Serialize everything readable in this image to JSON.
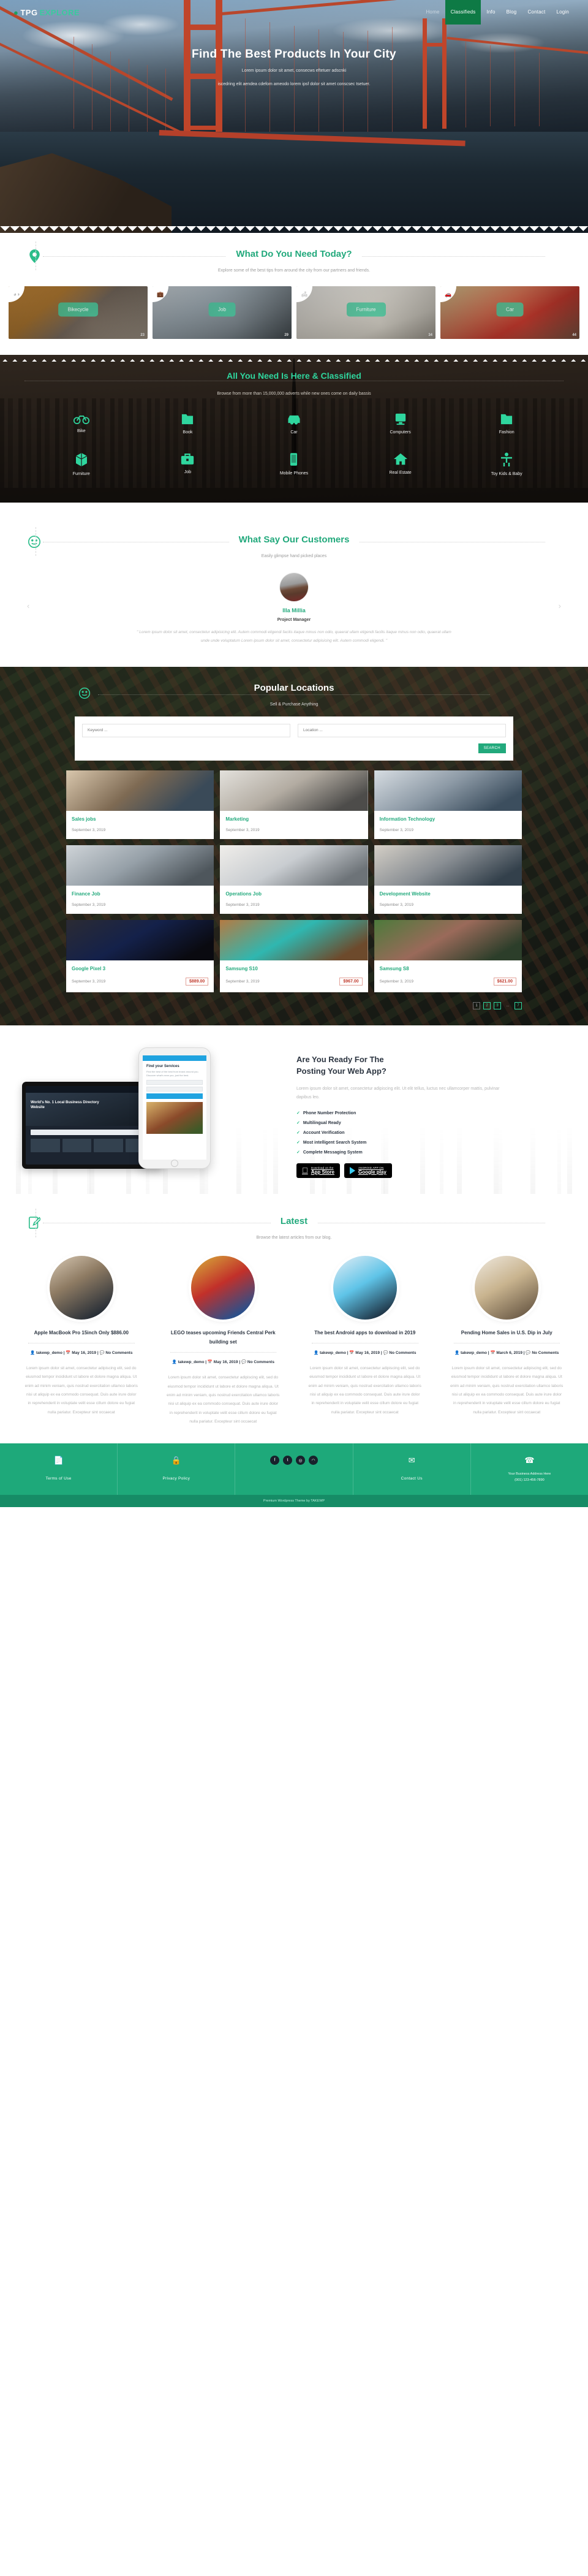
{
  "site": {
    "logo_mark": "location-pin-icon",
    "logo_primary": "TPG",
    "logo_secondary": "EXPLORE"
  },
  "nav": {
    "items": [
      {
        "label": "Home",
        "active": false
      },
      {
        "label": "Classifieds",
        "active": true
      },
      {
        "label": "Info",
        "active": false
      },
      {
        "label": "Blog",
        "active": false
      },
      {
        "label": "Contact",
        "active": false
      },
      {
        "label": "Login",
        "active": false
      }
    ]
  },
  "hero": {
    "title": "Find The Best Products In Your City",
    "subtitle_line1": "Lorem ipsum dolor sit amet, consecws eftetuer adscnki",
    "subtitle_line2": "iscedring elit aendea cdefom ameodo lorem ipsf dolor sit amet conscsec tsetuer."
  },
  "needs": {
    "icon": "map-pin-icon",
    "title": "What Do You Need Today?",
    "subtitle": "Explore some of the best tips from around the city from our partners and friends.",
    "categories": [
      {
        "label": "Bikecycle",
        "count": "23",
        "icon": "bicycle-icon",
        "theme": "cat-bike"
      },
      {
        "label": "Job",
        "count": "29",
        "icon": "briefcase-icon",
        "theme": "cat-job"
      },
      {
        "label": "Furniture",
        "count": "34",
        "icon": "furniture-icon",
        "theme": "cat-furn"
      },
      {
        "label": "Car",
        "count": "44",
        "icon": "car-icon",
        "theme": "cat-car"
      }
    ]
  },
  "classified": {
    "title": "All You Need Is Here & Classified",
    "subtitle": "Browse from more than 15,000,000 adverts while new ones come on daily bassis",
    "items": [
      {
        "label": "Bike",
        "icon": "bicycle-icon"
      },
      {
        "label": "Book",
        "icon": "book-icon"
      },
      {
        "label": "Car",
        "icon": "car-icon"
      },
      {
        "label": "Computers",
        "icon": "monitor-icon"
      },
      {
        "label": "Fashion",
        "icon": "shirt-icon"
      },
      {
        "label": "Furniture",
        "icon": "cube-icon"
      },
      {
        "label": "Job",
        "icon": "briefcase-icon"
      },
      {
        "label": "Mobile Phones",
        "icon": "smartphone-icon"
      },
      {
        "label": "Real Estate",
        "icon": "house-icon"
      },
      {
        "label": "Toy Kids & Baby",
        "icon": "child-icon"
      }
    ]
  },
  "testimonials": {
    "icon": "smiley-icon",
    "title": "What Say Our Customers",
    "subtitle": "Easily glimpse hand picked places",
    "prev": "‹",
    "next": "›",
    "current": {
      "name": "Illa Millia",
      "role": "Project Manager",
      "quote": "\" Lorem ipsum dolor sit amet, consectetur adipisicing elit. Autem commodi eligendi facilis itaque minus non odio, quaerat ullam eligendi facilis itaque minus non odio, quaerat ullam unde unde voluptatum Lorem ipsum dolor sit amet, consectetur adipisicing elit. Autem commodi eligendi. \""
    }
  },
  "locations": {
    "icon": "smiley-icon",
    "title": "Popular Locations",
    "subtitle": "Sell & Purchase Anything",
    "search": {
      "keyword_placeholder": "Keyword ...",
      "location_placeholder": "Location ...",
      "button_label": "SEARCH"
    },
    "listings": [
      {
        "title": "Sales jobs",
        "date": "September 3, 2019",
        "price": "",
        "theme": "t-sales"
      },
      {
        "title": "Marketing",
        "date": "September 3, 2019",
        "price": "",
        "theme": "t-marketing"
      },
      {
        "title": "Information Technology",
        "date": "September 3, 2019",
        "price": "",
        "theme": "t-it"
      },
      {
        "title": "Finance Job",
        "date": "September 3, 2019",
        "price": "",
        "theme": "t-finance"
      },
      {
        "title": "Operations Job",
        "date": "September 3, 2019",
        "price": "",
        "theme": "t-ops"
      },
      {
        "title": "Development Website",
        "date": "September 3, 2019",
        "price": "",
        "theme": "t-dev"
      },
      {
        "title": "Google Pixel 3",
        "date": "September 3, 2019",
        "price": "$889.00",
        "theme": "t-pixel"
      },
      {
        "title": "Samsung S10",
        "date": "September 3, 2019",
        "price": "$967.00",
        "theme": "t-s10"
      },
      {
        "title": "Samsung S8",
        "date": "September 3, 2019",
        "price": "$621.00",
        "theme": "t-s8"
      }
    ],
    "pagination": [
      "1",
      "2",
      "3",
      "...",
      "7"
    ]
  },
  "promo": {
    "heading_line1": "Are You Ready For The",
    "heading_line2": "Posting Your Web App?",
    "lead": "Lorem ipsum dolor sit amet, consectetur adipiscing elit. Ut elit tellus, luctus nec ullamcorper mattis, pulvinar dapibus leo.",
    "features": [
      "Phone Number Protection",
      "Multilingual Ready",
      "Account Verification",
      "Most intelligent Search System",
      "Complete Messaging System"
    ],
    "stores": [
      {
        "top": "Download on the",
        "bottom": "App Store",
        "icon": "apple-icon"
      },
      {
        "top": "ANDROID APP ON",
        "bottom": "Google play",
        "icon": "google-play-icon"
      }
    ],
    "device_screen": {
      "tablet_title": "World's No. 1 Local Business Directory Website",
      "tablet_brand": "Web Site",
      "phone_title": "Find your Services",
      "phone_text": "Find the best of the best from brand around you. Discover what's near you, just the best."
    }
  },
  "blog": {
    "icon": "pencil-edit-icon",
    "title": "Latest",
    "subtitle": "Browse the latest articles from our blog.",
    "posts": [
      {
        "title": "Apple MacBook Pro 15inch Only $886.00",
        "author": "takewp_demo",
        "date": "May 16, 2019",
        "comments": "No Comments",
        "excerpt": "Lorem ipsum dolor sit amet, consectetur adipiscing elit, sed do eiusmod tempor incididunt ut labore et dolore magna aliqua. Ut enim ad minim veniam, quis nostrud exercitation ullamco laboris nisi ut aliquip ex ea commodo consequat. Duis aute irure dolor in reprehenderit in voluptate velit esse cillum dolore eu fugiat nulla pariatur. Excepteur sint occaecat",
        "theme": "p1"
      },
      {
        "title": "LEGO teases upcoming Friends Central Perk building set",
        "author": "takewp_demo",
        "date": "May 16, 2019",
        "comments": "No Comments",
        "excerpt": "Lorem ipsum dolor sit amet, consectetur adipiscing elit, sed do eiusmod tempor incididunt ut labore et dolore magna aliqua. Ut enim ad minim veniam, quis nostrud exercitation ullamco laboris nisi ut aliquip ex ea commodo consequat. Duis aute irure dolor in reprehenderit in voluptate velit esse cillum dolore eu fugiat nulla pariatur. Excepteur sint occaecat",
        "theme": "p2"
      },
      {
        "title": "The best Android apps to download in 2019",
        "author": "takewp_demo",
        "date": "May 16, 2019",
        "comments": "No Comments",
        "excerpt": "Lorem ipsum dolor sit amet, consectetur adipiscing elit, sed do eiusmod tempor incididunt ut labore et dolore magna aliqua. Ut enim ad minim veniam, quis nostrud exercitation ullamco laboris nisi ut aliquip ex ea commodo consequat. Duis aute irure dolor in reprehenderit in voluptate velit esse cillum dolore eu fugiat nulla pariatur. Excepteur sint occaecat",
        "theme": "p3"
      },
      {
        "title": "Pending Home Sales in U.S. Dip in July",
        "author": "takewp_demo",
        "date": "March 6, 2019",
        "comments": "No Comments",
        "excerpt": "Lorem ipsum dolor sit amet, consectetur adipiscing elit, sed do eiusmod tempor incididunt ut labore et dolore magna aliqua. Ut enim ad minim veniam, quis nostrud exercitation ullamco laboris nisi ut aliquip ex ea commodo consequat. Duis aute irure dolor in reprehenderit in voluptate velit esse cillum dolore eu fugiat nulla pariatur. Excepteur sint occaecat",
        "theme": "p4"
      }
    ]
  },
  "footer": {
    "terms_icon": "document-icon",
    "terms_label": "Terms of Use",
    "privacy_icon": "lock-icon",
    "privacy_label": "Privacy Policy",
    "social": [
      {
        "icon": "facebook-icon",
        "glyph": "f"
      },
      {
        "icon": "twitter-icon",
        "glyph": "t"
      },
      {
        "icon": "instagram-icon",
        "glyph": "◎"
      },
      {
        "icon": "rss-icon",
        "glyph": "◠"
      }
    ],
    "contact_icon": "envelope-icon",
    "contact_label": "Contact Us",
    "phone_icon": "phone-icon",
    "phone_label": "Your Business Address Here",
    "phone_number": "(001) 123-456-7890",
    "copyright": "Premium Wordpress Theme by TAKEWP"
  },
  "colors": {
    "accent": "#22a97c",
    "accent_light": "#2fd69e",
    "price": "#c0392b",
    "footer": "#1ea97a"
  }
}
